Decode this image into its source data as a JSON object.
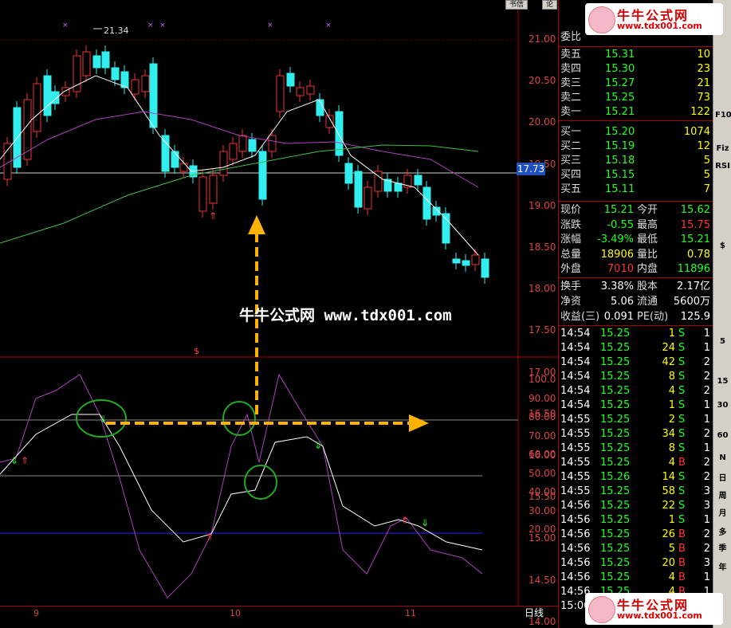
{
  "chart": {
    "price_axis": [
      "21.00",
      "20.50",
      "20.00",
      "19.50",
      "19.00",
      "18.50",
      "18.00",
      "17.50",
      "17.00",
      "16.50",
      "16.00",
      "15.50",
      "15.00",
      "14.50",
      "14.00"
    ],
    "current_price_tag": "17.73",
    "high_marker": "21.34",
    "indicator_axis": [
      "100.0",
      "90.00",
      "80.00",
      "70.00",
      "60.00",
      "50.00",
      "40.00",
      "30.00",
      "20.00"
    ],
    "x_labels": [
      "9",
      "10",
      "11"
    ],
    "period": "日线",
    "watermark": "牛牛公式网 www.tdx001.com",
    "logo_title": "牛牛公式网",
    "logo_url": "www.tdx001.com",
    "top_buttons": [
      "书信",
      "论"
    ]
  },
  "quote": {
    "header": "委比",
    "asks": [
      {
        "label": "卖五",
        "price": "15.31",
        "vol": "10"
      },
      {
        "label": "卖四",
        "price": "15.30",
        "vol": "23"
      },
      {
        "label": "卖三",
        "price": "15.27",
        "vol": "21"
      },
      {
        "label": "卖二",
        "price": "15.25",
        "vol": "73"
      },
      {
        "label": "卖一",
        "price": "15.21",
        "vol": "122"
      }
    ],
    "bids": [
      {
        "label": "买一",
        "price": "15.20",
        "vol": "1074"
      },
      {
        "label": "买二",
        "price": "15.19",
        "vol": "12"
      },
      {
        "label": "买三",
        "price": "15.18",
        "vol": "5"
      },
      {
        "label": "买四",
        "price": "15.15",
        "vol": "5"
      },
      {
        "label": "买五",
        "price": "15.11",
        "vol": "7"
      }
    ],
    "stats": [
      {
        "l1": "现价",
        "v1": "15.21",
        "l2": "今开",
        "v2": "15.62"
      },
      {
        "l1": "涨跌",
        "v1": "-0.55",
        "l2": "最高",
        "v2": "15.75"
      },
      {
        "l1": "涨幅",
        "v1": "-3.49%",
        "l2": "最低",
        "v2": "15.21"
      },
      {
        "l1": "总量",
        "v1": "18906",
        "l2": "量比",
        "v2": "0.78"
      },
      {
        "l1": "外盘",
        "v1": "7010",
        "l2": "内盘",
        "v2": "11896"
      }
    ],
    "stats2": [
      {
        "l1": "换手",
        "v1": "3.38%",
        "l2": "股本",
        "v2": "2.17亿"
      },
      {
        "l1": "净资",
        "v1": "5.06",
        "l2": "流通",
        "v2": "5600万"
      },
      {
        "l1": "收益(三)",
        "v1": "0.091",
        "l2": "PE(动)",
        "v2": "125.9"
      }
    ],
    "ticks": [
      {
        "t": "14:54",
        "p": "15.25",
        "v": "1",
        "s": "S",
        "n": "1"
      },
      {
        "t": "14:54",
        "p": "15.25",
        "v": "24",
        "s": "S",
        "n": "1"
      },
      {
        "t": "14:54",
        "p": "15.25",
        "v": "42",
        "s": "S",
        "n": "2"
      },
      {
        "t": "14:54",
        "p": "15.25",
        "v": "8",
        "s": "S",
        "n": "2"
      },
      {
        "t": "14:54",
        "p": "15.25",
        "v": "4",
        "s": "S",
        "n": "2"
      },
      {
        "t": "14:54",
        "p": "15.25",
        "v": "1",
        "s": "S",
        "n": "1"
      },
      {
        "t": "14:55",
        "p": "15.25",
        "v": "2",
        "s": "S",
        "n": "1"
      },
      {
        "t": "14:55",
        "p": "15.25",
        "v": "34",
        "s": "S",
        "n": "2"
      },
      {
        "t": "14:55",
        "p": "15.25",
        "v": "8",
        "s": "S",
        "n": "1"
      },
      {
        "t": "14:55",
        "p": "15.25",
        "v": "4",
        "s": "B",
        "n": "2"
      },
      {
        "t": "14:55",
        "p": "15.26",
        "v": "14",
        "s": "S",
        "n": "2"
      },
      {
        "t": "14:55",
        "p": "15.25",
        "v": "58",
        "s": "S",
        "n": "3"
      },
      {
        "t": "14:56",
        "p": "15.25",
        "v": "22",
        "s": "S",
        "n": "3"
      },
      {
        "t": "14:56",
        "p": "15.25",
        "v": "1",
        "s": "S",
        "n": "1"
      },
      {
        "t": "14:56",
        "p": "15.25",
        "v": "26",
        "s": "B",
        "n": "2"
      },
      {
        "t": "14:56",
        "p": "15.25",
        "v": "5",
        "s": "B",
        "n": "2"
      },
      {
        "t": "14:56",
        "p": "15.25",
        "v": "20",
        "s": "B",
        "n": "3"
      },
      {
        "t": "14:56",
        "p": "15.25",
        "v": "4",
        "s": "B",
        "n": "1"
      },
      {
        "t": "14:56",
        "p": "15.25",
        "v": "4",
        "s": "B",
        "n": "1"
      },
      {
        "t": "15:00",
        "p": "15.21",
        "v": "",
        "s": "",
        "n": ""
      }
    ],
    "ticks_visible_rows": 20
  },
  "toolbar": [
    "F10",
    "Fiz",
    "RSI",
    "$",
    "5",
    "15",
    "30",
    "60",
    "N",
    "日",
    "周",
    "月",
    "多",
    "季",
    "年"
  ],
  "colors": {
    "up": "#ff3333",
    "down": "#00ffff",
    "ma_white": "#ffffff",
    "ma_purple": "#b040c0",
    "ma_green": "#40c040",
    "accent": "#ffb300"
  }
}
